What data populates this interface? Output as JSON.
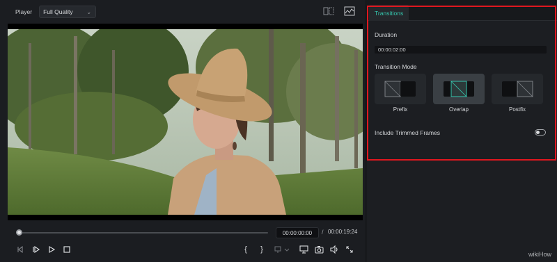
{
  "player": {
    "label": "Player",
    "quality": {
      "selected": "Full Quality"
    },
    "icons": [
      "compare-view-icon",
      "waveform-icon"
    ]
  },
  "timeline": {
    "current_time": "00:00:00:00",
    "separator": "/",
    "total_time": "00:00:19:24",
    "progress": 0
  },
  "controls": {
    "icons": [
      "prev-frame-icon",
      "play-step-icon",
      "play-icon",
      "stop-icon",
      "mark-in-icon",
      "mark-out-icon",
      "snapshot-menu-icon",
      "display-icon",
      "camera-icon",
      "volume-icon",
      "fullscreen-icon"
    ],
    "mark_in": "{",
    "mark_out": "}"
  },
  "panel": {
    "tab": "Transitions",
    "duration": {
      "label": "Duration",
      "value": "00:00:02:00"
    },
    "transition_mode": {
      "label": "Transition Mode",
      "options": [
        {
          "label": "Prefix",
          "selected": false
        },
        {
          "label": "Overlap",
          "selected": true
        },
        {
          "label": "Postfix",
          "selected": false
        }
      ]
    },
    "trimmed_frames": {
      "label": "Include Trimmed Frames",
      "enabled": false
    }
  },
  "colors": {
    "accent": "#35c6ad",
    "highlight": "#e0171f",
    "bg": "#1b1d21"
  },
  "watermark": "wikiHow"
}
